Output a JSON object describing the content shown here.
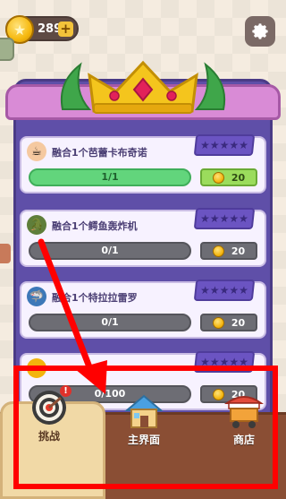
{
  "top_bar": {
    "coin_count": "289",
    "plus_label": "+"
  },
  "tasks": [
    {
      "title": "融合1个芭蕾卡布奇诺",
      "progress": "1/1",
      "progress_fraction": 1.0,
      "reward": "20",
      "completed": true,
      "icon": "ballerina-cappuccino-icon"
    },
    {
      "title": "融合1个鳄鱼轰炸机",
      "progress": "0/1",
      "progress_fraction": 0.0,
      "reward": "20",
      "completed": false,
      "icon": "crocodile-bomber-icon"
    },
    {
      "title": "融合1个特拉拉雷罗",
      "progress": "0/1",
      "progress_fraction": 0.0,
      "reward": "20",
      "completed": false,
      "icon": "shark-tralalero-icon"
    },
    {
      "title": "",
      "progress": "0/100",
      "progress_fraction": 0.0,
      "reward": "20",
      "completed": false,
      "icon": "coin-task-icon"
    }
  ],
  "nav": {
    "challenge_label": "挑战",
    "home_label": "主界面",
    "shop_label": "商店",
    "challenge_badge": "!"
  },
  "colors": {
    "panel": "#5f4fa8",
    "header": "#d98bd6",
    "progress_done": "#62d57c",
    "annotation": "#ff0000"
  }
}
